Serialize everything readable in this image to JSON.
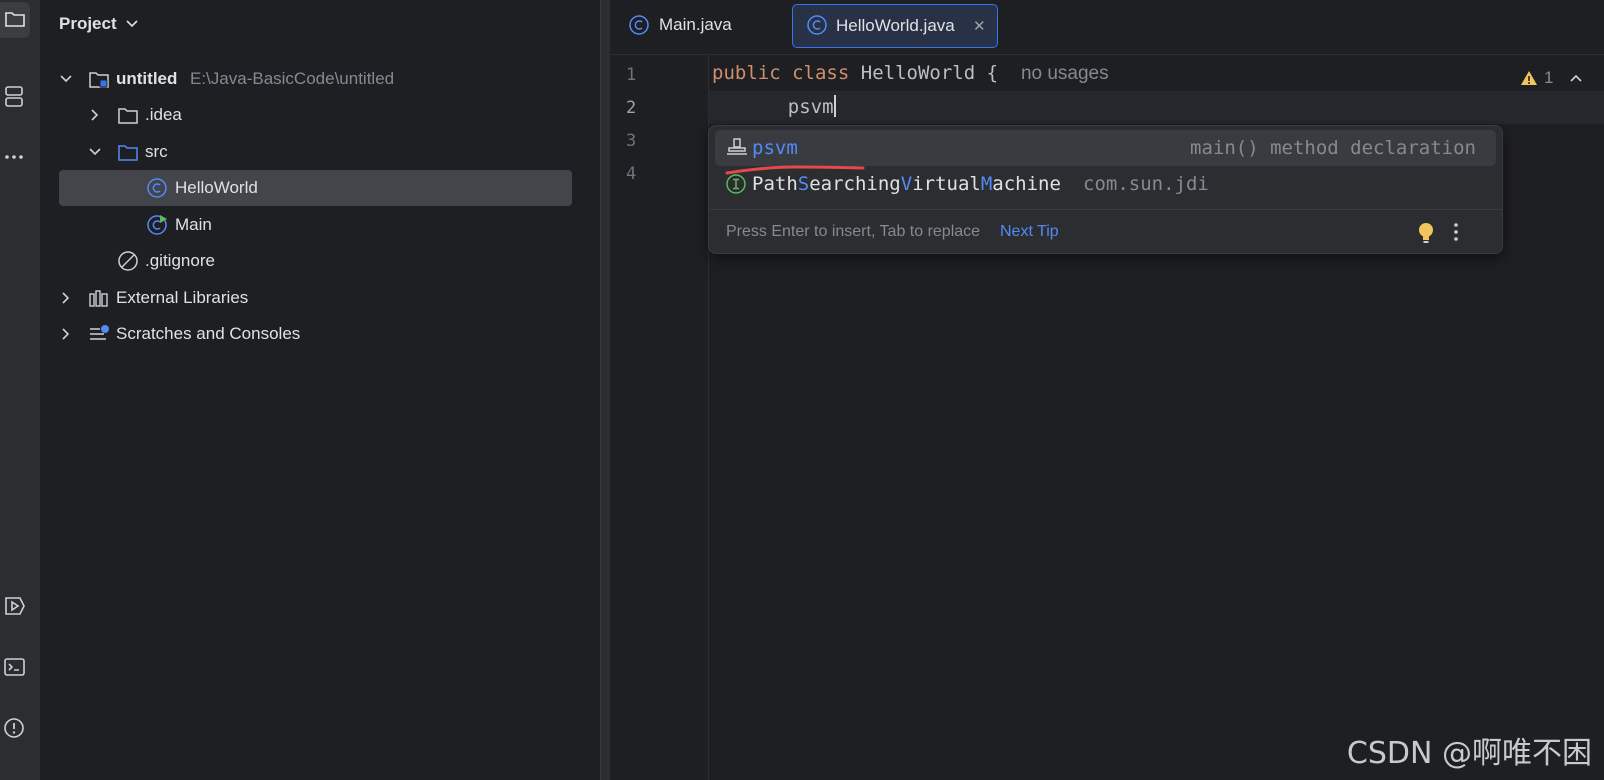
{
  "project": {
    "title": "Project",
    "tree": [
      {
        "label": "untitled",
        "path": "E:\\Java-BasicCode\\untitled"
      },
      {
        "label": ".idea"
      },
      {
        "label": "src"
      },
      {
        "label": "HelloWorld"
      },
      {
        "label": "Main"
      },
      {
        "label": ".gitignore"
      },
      {
        "label": "External Libraries"
      },
      {
        "label": "Scratches and Consoles"
      }
    ]
  },
  "tabs": [
    {
      "label": "Main.java"
    },
    {
      "label": "HelloWorld.java",
      "close": "✕"
    }
  ],
  "editor": {
    "line_numbers": [
      "1",
      "2",
      "3",
      "4"
    ],
    "line1": {
      "kw1": "public",
      "kw2": "class",
      "name": "HelloWorld",
      "brace": "{",
      "hint": "no usages"
    },
    "line2": {
      "text": "psvm"
    }
  },
  "completion": {
    "items": [
      {
        "label": "psvm",
        "detail": "main() method declaration"
      },
      {
        "parts": [
          "Path",
          "S",
          "earching",
          "V",
          "irtual",
          "M",
          "achine"
        ],
        "detail": "com.sun.jdi"
      }
    ],
    "footer_text": "Press Enter to insert, Tab to replace",
    "footer_link": "Next Tip"
  },
  "inspections": {
    "warnings": "1"
  },
  "watermark": "CSDN @啊唯不困",
  "colors": {
    "accent": "#3574f0",
    "keyword": "#cf8e6d",
    "link": "#548af7",
    "annotation_underline": "#e5484d"
  }
}
